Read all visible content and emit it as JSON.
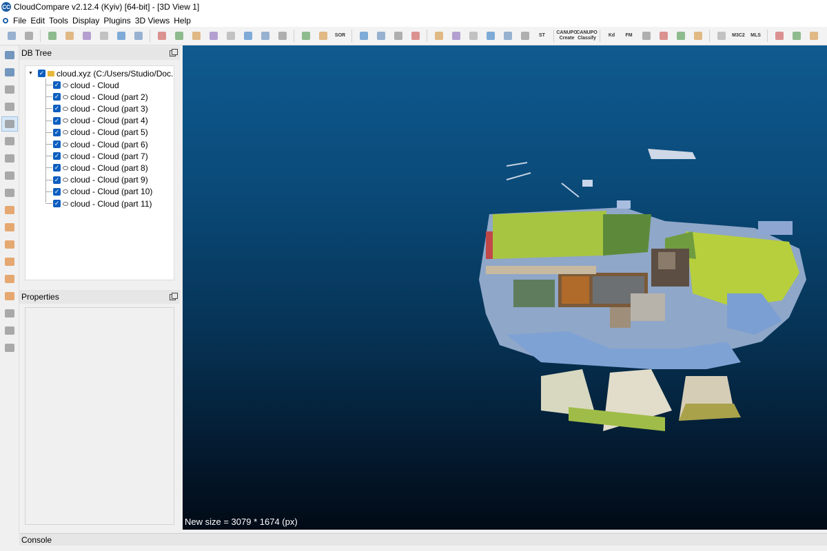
{
  "window": {
    "title": "CloudCompare v2.12.4 (Kyiv) [64-bit] - [3D View 1]",
    "logo_text": "CC"
  },
  "menu": [
    "File",
    "Edit",
    "Tools",
    "Display",
    "Plugins",
    "3D Views",
    "Help"
  ],
  "toolbar": {
    "icons": [
      "open-icon",
      "save-icon",
      "sep",
      "transform-icon",
      "list-icon",
      "add-point-icon",
      "segment-icon",
      "merge-icon",
      "delete-icon",
      "sep",
      "clone-icon",
      "filter-icon",
      "smooth-icon",
      "resample-icon",
      "normal-icon",
      "subsample-icon",
      "sample-points-icon",
      "octree-icon",
      "sep",
      "label-icon",
      "checkerboard-icon",
      "sor-icon",
      "sep",
      "scissors-icon",
      "crosshair-icon",
      "plane-icon",
      "edit-icon",
      "sep",
      "histogram-icon",
      "stats-icon",
      "filter-sf-icon",
      "equalizer-icon",
      "plus-icon",
      "minus-icon",
      "st-icon",
      "sep",
      "canupo-create",
      "canupo-classify",
      "sep",
      "kd-icon",
      "fm-icon",
      "compass-icon",
      "disk-icon",
      "sphere-icon",
      "globe-icon",
      "sep",
      "link-icon",
      "m3c2-icon",
      "mls-icon",
      "sep",
      "bullet-icon",
      "split-icon",
      "tool-icon"
    ],
    "labels": {
      "sor": "SOR",
      "st": "ST",
      "canupo_title": "CANUPO",
      "canupo_create": "Create",
      "canupo_classify": "Classify",
      "kd": "Kd",
      "fm": "FM",
      "m3c2": "M3C2",
      "mls": "MLS"
    }
  },
  "left_toolbar": [
    "monitor-icon",
    "camera-icon",
    "pause-icon",
    "plus-icon",
    "pivot-icon",
    "front-view-icon",
    "cube-view-icon",
    "zoom-icon",
    "search-icon",
    "view-top-icon",
    "view-front-icon",
    "view-left-icon",
    "view-back-icon",
    "view-right-icon",
    "view-bottom-icon",
    "iso-view1-icon",
    "iso-view2-icon",
    "color-icon"
  ],
  "db_tree": {
    "title": "DB Tree",
    "root": "cloud.xyz (C:/Users/Studio/Doc...",
    "items": [
      "cloud - Cloud",
      "cloud - Cloud (part 2)",
      "cloud - Cloud (part 3)",
      "cloud - Cloud (part 4)",
      "cloud - Cloud (part 5)",
      "cloud - Cloud (part 6)",
      "cloud - Cloud (part 7)",
      "cloud - Cloud (part 8)",
      "cloud - Cloud (part 9)",
      "cloud - Cloud (part 10)",
      "cloud - Cloud (part 11)"
    ]
  },
  "properties": {
    "title": "Properties"
  },
  "view": {
    "message": "New size = 3079 * 1674 (px)"
  },
  "console": {
    "title": "Console"
  }
}
